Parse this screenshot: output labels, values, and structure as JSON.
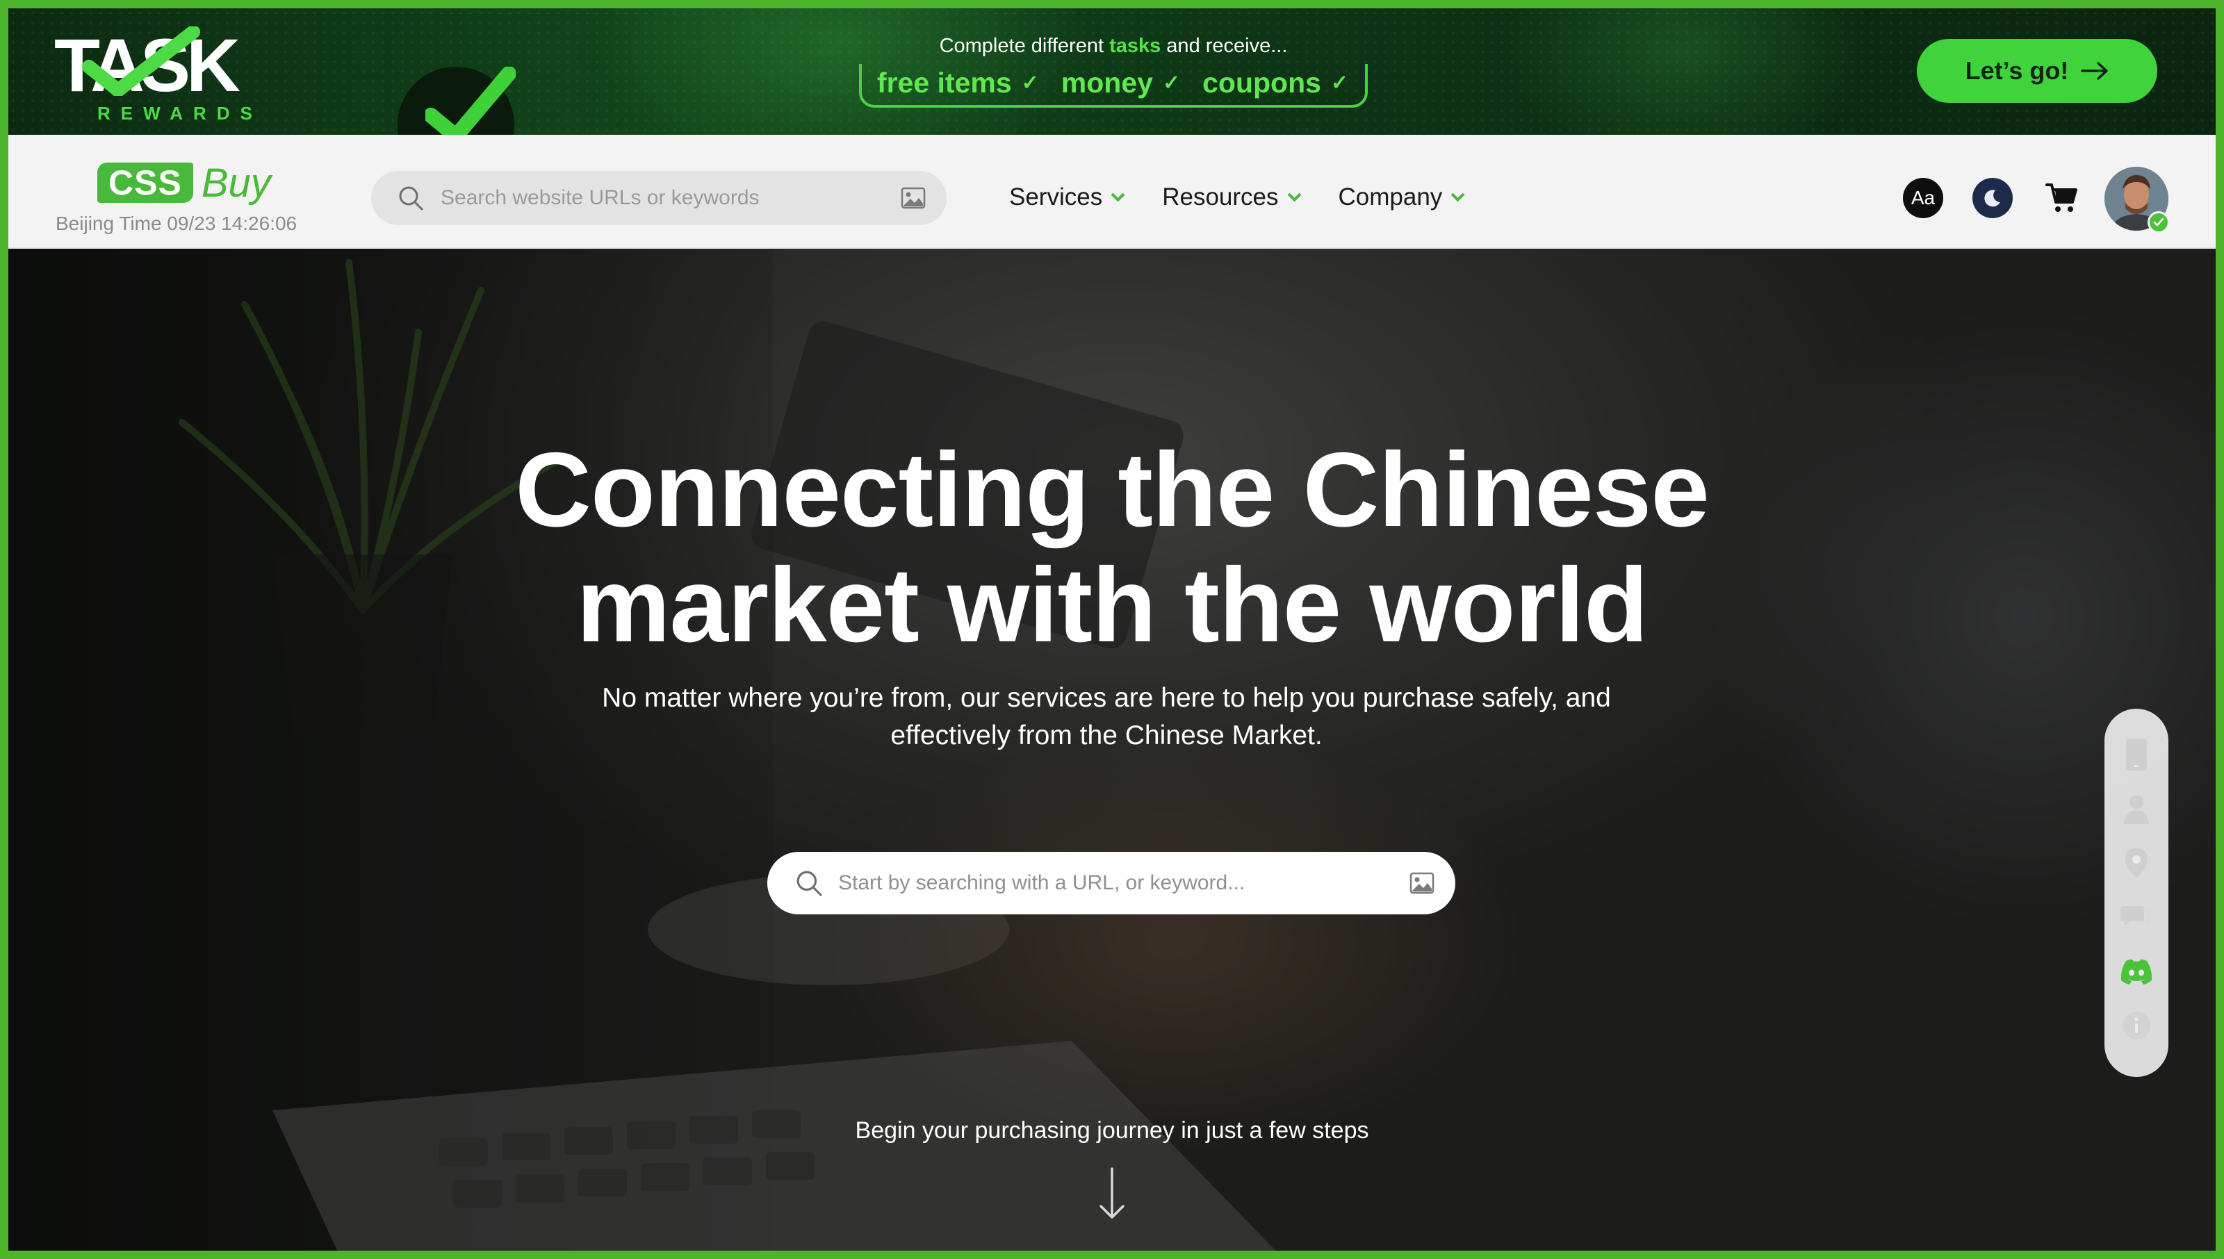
{
  "promo": {
    "logo_word": "TASK",
    "logo_sub": "REWARDS",
    "line1_pre": "Complete different ",
    "line1_highlight": "tasks",
    "line1_post": " and receive...",
    "chips": [
      "free items",
      "money",
      "coupons"
    ],
    "cta_label": "Let’s go!",
    "accent_color": "#41d33b"
  },
  "header": {
    "logo_badge": "CSS",
    "logo_text": "Buy",
    "beijing_time": "Beijing Time 09/23 14:26:06",
    "search_placeholder": "Search website URLs or keywords",
    "nav": [
      {
        "label": "Services"
      },
      {
        "label": "Resources"
      },
      {
        "label": "Company"
      }
    ],
    "font_toggle_label": "Aa",
    "icons": [
      "search-icon",
      "image-search-icon",
      "font-size-icon",
      "dark-mode-icon",
      "cart-icon",
      "avatar"
    ]
  },
  "hero": {
    "title_line1": "Connecting the Chinese",
    "title_line2": "market with the world",
    "subtitle_line1": "No matter where you’re from, our services are here to help you purchase safely, and",
    "subtitle_line2": "effectively from the Chinese Market.",
    "search_placeholder": "Start by searching with a URL, or keyword...",
    "steps_text": "Begin your purchasing journey in just a few steps"
  },
  "side_dock": {
    "items": [
      "mobile-icon",
      "user-icon",
      "location-icon",
      "chat-icon",
      "discord-icon",
      "info-icon"
    ]
  },
  "colors": {
    "brand_green": "#48b93a",
    "frame_green": "#4db52c",
    "header_bg": "#f3f3f3"
  }
}
